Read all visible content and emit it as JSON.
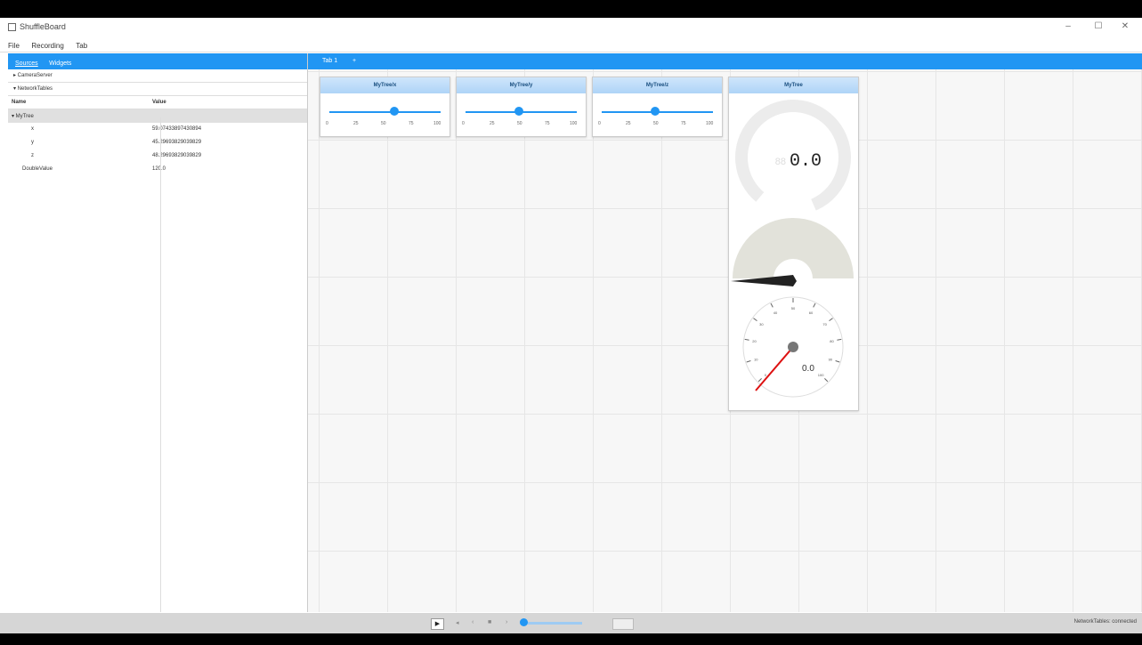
{
  "window": {
    "title": "ShuffleBoard",
    "minimize": "–",
    "maximize": "☐",
    "close": "✕"
  },
  "menu": [
    "File",
    "Recording",
    "Tab"
  ],
  "left_panel": {
    "tabs": [
      "Sources",
      "Widgets"
    ],
    "sources": [
      "▸ CameraServer",
      "▾ NetworkTables"
    ],
    "columns": {
      "name": "Name",
      "value": "Value"
    },
    "rows": [
      {
        "name": "▾ MyTree",
        "value": ""
      },
      {
        "name": "x",
        "value": "59.07433897430894"
      },
      {
        "name": "y",
        "value": "45.29693829039829"
      },
      {
        "name": "z",
        "value": "48.29693829039829"
      },
      {
        "name": "DoubleValue",
        "value": "120.0"
      }
    ]
  },
  "tabs": {
    "label": "Tab 1",
    "add": "+"
  },
  "widgets": {
    "sliders": [
      {
        "title": "MyTree/x",
        "value": 0.58,
        "ticks": [
          "0",
          "25",
          "50",
          "75",
          "100"
        ]
      },
      {
        "title": "MyTree/y",
        "value": 0.48,
        "ticks": [
          "0",
          "25",
          "50",
          "75",
          "100"
        ]
      },
      {
        "title": "MyTree/z",
        "value": 0.48,
        "ticks": [
          "0",
          "25",
          "50",
          "75",
          "100"
        ]
      }
    ],
    "gauge": {
      "title": "MyTree",
      "digital_value": "0.0",
      "dial_value": "0.0",
      "dial_ticks": [
        "0",
        "10",
        "20",
        "30",
        "40",
        "50",
        "60",
        "70",
        "80",
        "90",
        "100"
      ]
    }
  },
  "status": {
    "play": "▶",
    "label": "NetworkTables: connected"
  }
}
